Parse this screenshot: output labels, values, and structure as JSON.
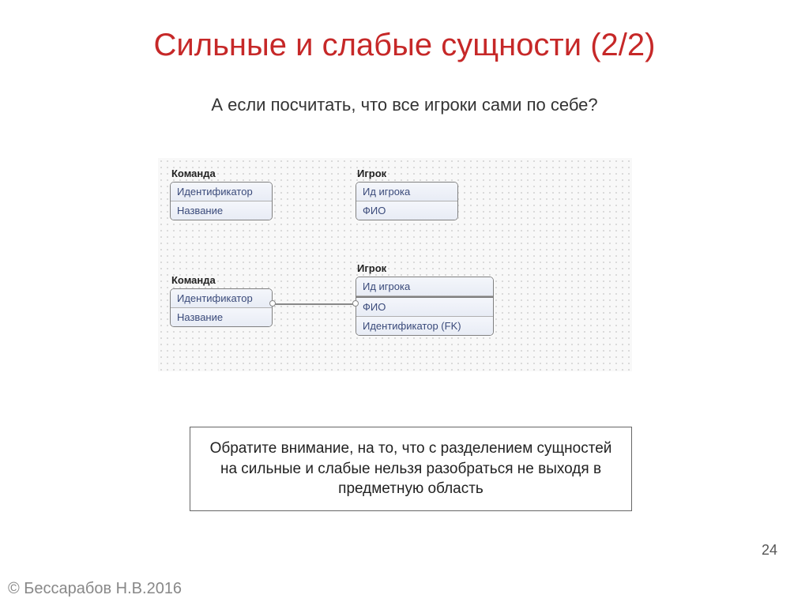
{
  "title": "Сильные и слабые сущности (2/2)",
  "subtitle": "А если посчитать, что все игроки сами по себе?",
  "entities": {
    "team1": {
      "name": "Команда",
      "rows": [
        "Идентификатор",
        "Название"
      ]
    },
    "player1": {
      "name": "Игрок",
      "rows": [
        "Ид игрока",
        "ФИО"
      ]
    },
    "team2": {
      "name": "Команда",
      "rows": [
        "Идентификатор",
        "Название"
      ]
    },
    "player2": {
      "name": "Игрок",
      "top": [
        "Ид игрока"
      ],
      "bottom": [
        "ФИО",
        "Идентификатор (FK)"
      ]
    }
  },
  "note": "Обратите внимание, на то, что с разделением сущностей на сильные и слабые нельзя разобраться не выходя в предметную область",
  "page_number": "24",
  "copyright": "© Бессарабов Н.В.2016"
}
